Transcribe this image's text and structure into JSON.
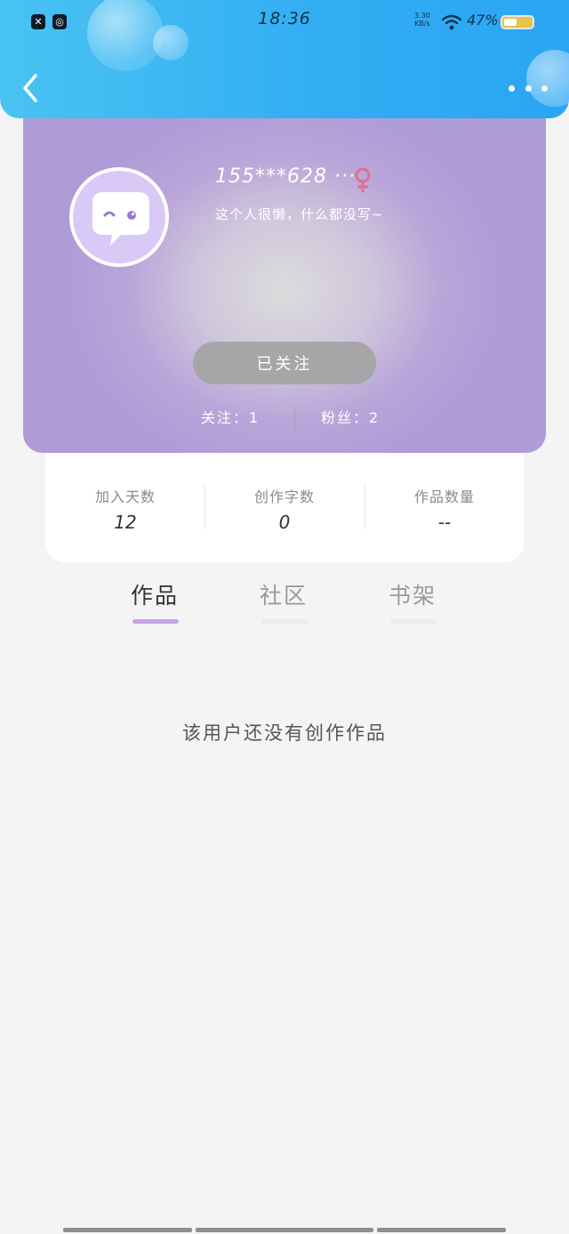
{
  "status_bar": {
    "time": "18:36",
    "speed_value": "3.30",
    "speed_unit": "KB/s",
    "battery": "47%",
    "app_icons": [
      "close-app-icon",
      "scan-app-icon"
    ]
  },
  "nav": {
    "back_icon": "chevron-left-icon",
    "more_icon": "more-dots-icon"
  },
  "profile": {
    "username": "155***628 ···",
    "gender_icon": "female-icon",
    "bio": "这个人很懒，什么都没写~",
    "follow_button": "已关注",
    "following": "关注：1",
    "fans": "粉丝：2",
    "colors": {
      "accent": "#c8a3e6",
      "header": "#33aef3",
      "card": "#ae9bd8"
    }
  },
  "stats": [
    {
      "label": "加入天数",
      "value": "12"
    },
    {
      "label": "创作字数",
      "value": "0"
    },
    {
      "label": "作品数量",
      "value": "--"
    }
  ],
  "tabs": [
    {
      "label": "作品",
      "active": true
    },
    {
      "label": "社区",
      "active": false
    },
    {
      "label": "书架",
      "active": false
    }
  ],
  "empty_state": "该用户还没有创作作品"
}
